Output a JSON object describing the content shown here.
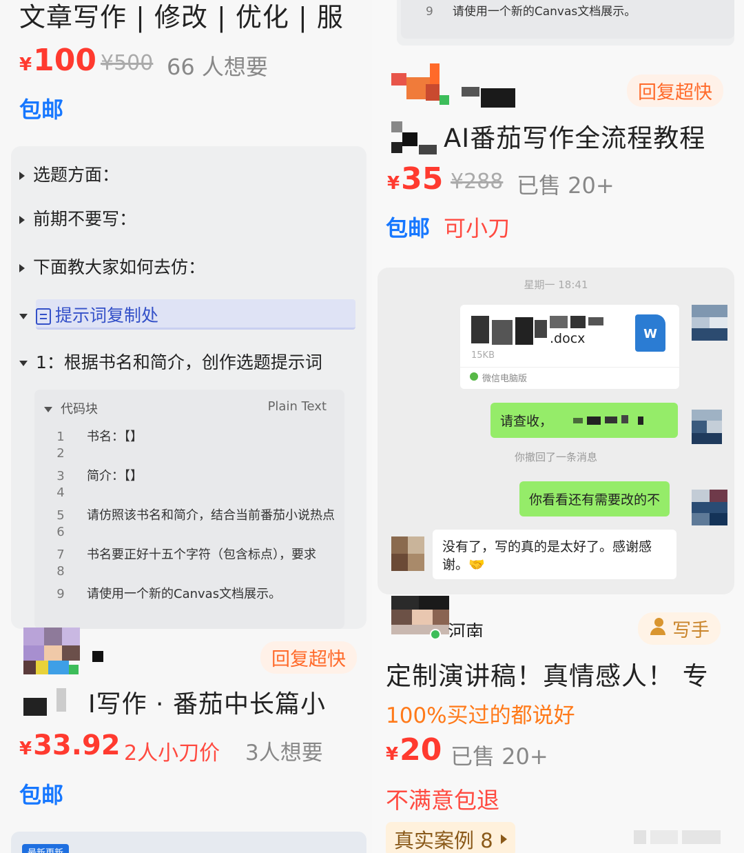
{
  "left": {
    "top_product": {
      "title": "文章写作 | 修改 | 优化 | 服",
      "currency": "¥",
      "price": "100",
      "original_price": "¥500",
      "wants": "66 人想要",
      "shipping": "包邮"
    },
    "doc": {
      "items": [
        "选题方面：",
        "前期不要写：",
        "下面教大家如何去仿："
      ],
      "prompt_copy": "提示词复制处",
      "section1": "1：根据书名和简介，创作选题提示词",
      "code_block_label": "代码块",
      "code_lang": "Plain Text",
      "code_lines": [
        {
          "n": "1",
          "text": "书名：【】"
        },
        {
          "n": "2",
          "text": ""
        },
        {
          "n": "3",
          "text": "简介：【】"
        },
        {
          "n": "4",
          "text": ""
        },
        {
          "n": "5",
          "text": "请仿照该书名和简介，结合当前番茄小说热点"
        },
        {
          "n": "6",
          "text": ""
        },
        {
          "n": "7",
          "text": "书名要正好十五个字符（包含标点），要求"
        },
        {
          "n": "8",
          "text": ""
        },
        {
          "n": "9",
          "text": "请使用一个新的Canvas文档展示。"
        }
      ]
    },
    "bottom_product": {
      "badge": "回复超快",
      "title": "I写作 · 番茄中长篇小",
      "currency": "¥",
      "price": "33.92",
      "bargain": "2人小刀价",
      "wants": "3人想要",
      "shipping": "包邮",
      "new_tag": "最新更新"
    }
  },
  "right": {
    "top_code_line": {
      "n": "9",
      "text": "请使用一个新的Canvas文档展示。"
    },
    "product1": {
      "badge": "回复超快",
      "title": "AI番茄写作全流程教程",
      "currency": "¥",
      "price": "35",
      "original_price": "¥288",
      "sold": "已售 20+",
      "shipping": "包邮",
      "bargain": "可小刀"
    },
    "chat": {
      "time": "星期一 18:41",
      "file_name": ".docx",
      "file_size": "15KB",
      "file_source": "微信电脑版",
      "file_icon_letter": "W",
      "msg1": "请查收，",
      "recall_notice": "你撤回了一条消息",
      "msg2": "你看看还有需要改的不",
      "reply": "没有了，写的真的是太好了。感谢感谢。🤝"
    },
    "product2": {
      "seller_name": "河南",
      "badge": "写手",
      "title": "定制演讲稿！真情感人！ 专",
      "review": "100%买过的都说好",
      "currency": "¥",
      "price": "20",
      "sold": "已售 20+",
      "guarantee": "不满意包退",
      "cases": "真实案例 8"
    }
  },
  "colors": {
    "price_red": "#ff3a2f",
    "shipping_blue": "#1677ff",
    "badge_orange": "#ff6a2a",
    "wechat_green": "#95ec69",
    "word_blue": "#2b7cd3"
  }
}
